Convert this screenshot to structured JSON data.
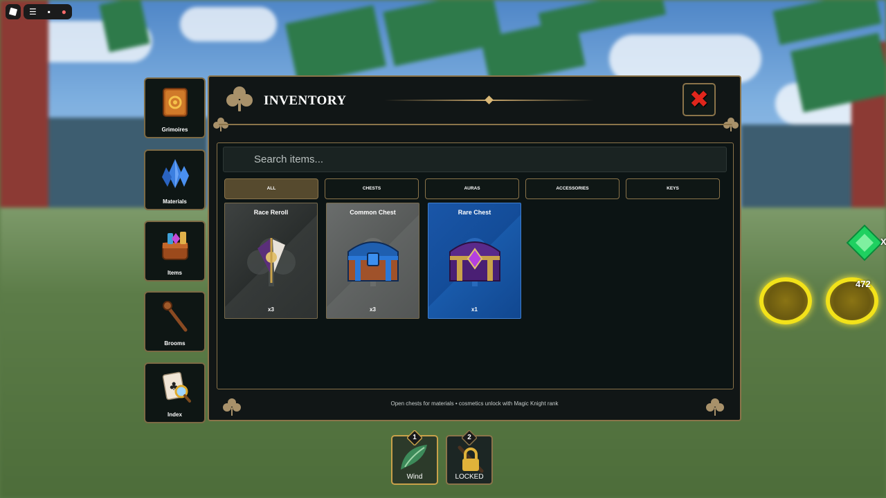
{
  "sidebar": {
    "items": [
      {
        "label": "Grimoires",
        "icon": "grimoire-book-icon"
      },
      {
        "label": "Materials",
        "icon": "crystal-icon"
      },
      {
        "label": "Items",
        "icon": "item-bag-icon"
      },
      {
        "label": "Brooms",
        "icon": "broom-icon"
      },
      {
        "label": "Index",
        "icon": "index-card-magnifier-icon"
      }
    ]
  },
  "panel": {
    "title": "INVENTORY",
    "search_placeholder": "Search items...",
    "filters": [
      {
        "label": "ALL",
        "active": true
      },
      {
        "label": "CHESTS",
        "active": false
      },
      {
        "label": "AURAS",
        "active": false
      },
      {
        "label": "ACCESSORIES",
        "active": false
      },
      {
        "label": "KEYS",
        "active": false
      }
    ],
    "items": [
      {
        "name": "Race Reroll",
        "qty": "x3",
        "rarity_color": "#2f3332"
      },
      {
        "name": "Common Chest",
        "qty": "x3",
        "rarity_color": "#5f6261"
      },
      {
        "name": "Rare Chest",
        "qty": "x1",
        "rarity_color": "#1a56a8"
      }
    ],
    "footer": "Open chests for materials  •  cosmetics unlock with Magic Knight rank"
  },
  "hotbar": [
    {
      "slot": "1",
      "label": "Wind",
      "icon": "wind-feather-icon"
    },
    {
      "slot": "2",
      "label": "LOCKED",
      "icon": "padlock-icon"
    }
  ],
  "hud": {
    "count": "472",
    "gem_glyph": "X"
  },
  "colors": {
    "gold_border": "#8b744a",
    "panel_bg": "#111616",
    "close_red": "#e0261c",
    "coin_yellow": "#f2e21a"
  }
}
